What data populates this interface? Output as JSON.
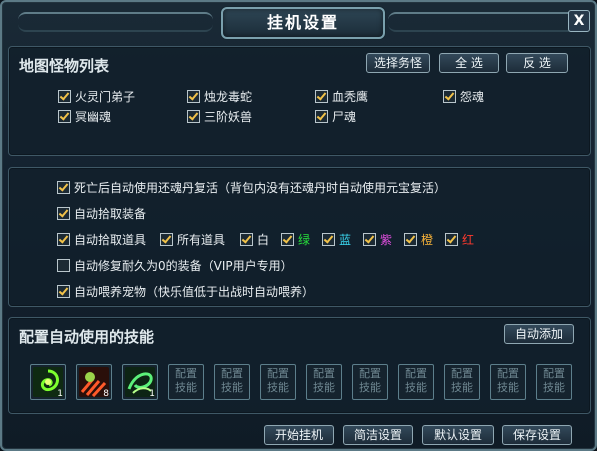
{
  "window": {
    "title": "挂机设置",
    "close_label": "X"
  },
  "monster_section": {
    "title": "地图怪物列表",
    "buttons": {
      "select_task": "选择务怪",
      "select_all": "全 选",
      "invert": "反 选"
    },
    "monsters": [
      {
        "label": "火灵门弟子",
        "checked": true
      },
      {
        "label": "烛龙毒蛇",
        "checked": true
      },
      {
        "label": "血秃鹰",
        "checked": true
      },
      {
        "label": "怨魂",
        "checked": true
      },
      {
        "label": "冥幽魂",
        "checked": true
      },
      {
        "label": "三阶妖兽",
        "checked": true
      },
      {
        "label": "尸魂",
        "checked": true
      }
    ]
  },
  "options": {
    "revive": {
      "label": "死亡后自动使用还魂丹复活（背包内没有还魂丹时自动使用元宝复活）",
      "checked": true
    },
    "pickup_equip": {
      "label": "自动拾取装备",
      "checked": true
    },
    "pickup_items": {
      "label": "自动拾取道具",
      "checked": true
    },
    "all_items": {
      "label": "所有道具",
      "checked": true
    },
    "qualities": [
      {
        "label": "白",
        "checked": true,
        "color": "#ffffff"
      },
      {
        "label": "绿",
        "checked": true,
        "color": "#27e03b"
      },
      {
        "label": "蓝",
        "checked": true,
        "color": "#3ad7f0"
      },
      {
        "label": "紫",
        "checked": true,
        "color": "#e14fe0"
      },
      {
        "label": "橙",
        "checked": true,
        "color": "#f7b23a"
      },
      {
        "label": "红",
        "checked": true,
        "color": "#ff3a2e"
      }
    ],
    "repair": {
      "label": "自动修复耐久为0的装备（VIP用户专用）",
      "checked": false
    },
    "feed_pet": {
      "label": "自动喂养宠物（快乐值低于出战时自动喂养）",
      "checked": true
    }
  },
  "skills_section": {
    "title": "配置自动使用的技能",
    "auto_add": "自动添加",
    "skills": [
      {
        "icon": "green-swirl-skill-icon",
        "count": "1"
      },
      {
        "icon": "red-claw-skill-icon",
        "count": "8"
      },
      {
        "icon": "green-vortex-skill-icon",
        "count": "1"
      }
    ],
    "empty_label": "配置技能"
  },
  "footer": {
    "start": "开始挂机",
    "simple": "简洁设置",
    "default": "默认设置",
    "save": "保存设置"
  }
}
